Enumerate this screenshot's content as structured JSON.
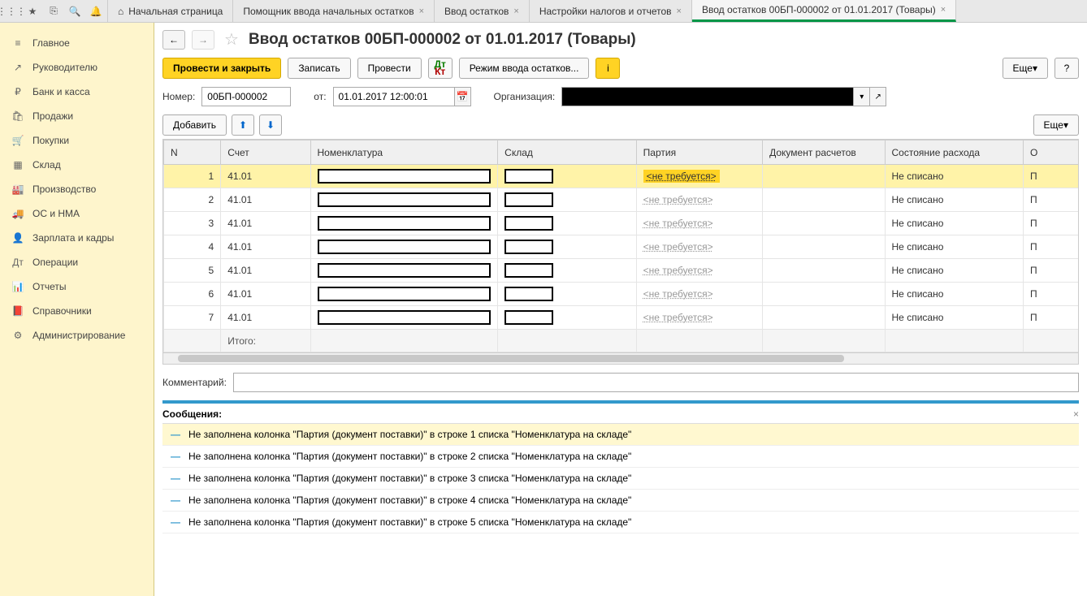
{
  "toolbar_icons": [
    "apps",
    "star",
    "clipboard",
    "search",
    "bell"
  ],
  "tabs": [
    {
      "label": "Начальная страница",
      "closable": false,
      "home": true
    },
    {
      "label": "Помощник ввода начальных остатков",
      "closable": true
    },
    {
      "label": "Ввод остатков",
      "closable": true
    },
    {
      "label": "Настройки налогов и отчетов",
      "closable": true
    },
    {
      "label": "Ввод остатков 00БП-000002 от 01.01.2017 (Товары)",
      "closable": true,
      "active": true
    }
  ],
  "sidebar": [
    {
      "icon": "≡",
      "label": "Главное"
    },
    {
      "icon": "↗",
      "label": "Руководителю"
    },
    {
      "icon": "₽",
      "label": "Банк и касса"
    },
    {
      "icon": "🛍",
      "label": "Продажи"
    },
    {
      "icon": "🛒",
      "label": "Покупки"
    },
    {
      "icon": "▦",
      "label": "Склад"
    },
    {
      "icon": "🏭",
      "label": "Производство"
    },
    {
      "icon": "🚚",
      "label": "ОС и НМА"
    },
    {
      "icon": "👤",
      "label": "Зарплата и кадры"
    },
    {
      "icon": "Дт",
      "label": "Операции"
    },
    {
      "icon": "📊",
      "label": "Отчеты"
    },
    {
      "icon": "📕",
      "label": "Справочники"
    },
    {
      "icon": "⚙",
      "label": "Администрирование"
    }
  ],
  "page_title": "Ввод остатков 00БП-000002 от 01.01.2017 (Товары)",
  "actions": {
    "post_close": "Провести и закрыть",
    "write": "Записать",
    "post": "Провести",
    "mode": "Режим ввода остатков...",
    "more": "Еще",
    "help": "?"
  },
  "form": {
    "number_label": "Номер:",
    "number_value": "00БП-000002",
    "from_label": "от:",
    "date_value": "01.01.2017 12:00:01",
    "org_label": "Организация:"
  },
  "table_toolbar": {
    "add": "Добавить",
    "more": "Еще"
  },
  "columns": {
    "n": "N",
    "account": "Счет",
    "nomenclature": "Номенклатура",
    "warehouse": "Склад",
    "party": "Партия",
    "doc": "Документ расчетов",
    "state": "Состояние расхода",
    "last": "О"
  },
  "rows": [
    {
      "n": "1",
      "account": "41.01",
      "party": "<не требуется>",
      "state": "Не списано",
      "last": "П",
      "selected": true
    },
    {
      "n": "2",
      "account": "41.01",
      "party": "<не требуется>",
      "state": "Не списано",
      "last": "П"
    },
    {
      "n": "3",
      "account": "41.01",
      "party": "<не требуется>",
      "state": "Не списано",
      "last": "П"
    },
    {
      "n": "4",
      "account": "41.01",
      "party": "<не требуется>",
      "state": "Не списано",
      "last": "П"
    },
    {
      "n": "5",
      "account": "41.01",
      "party": "<не требуется>",
      "state": "Не списано",
      "last": "П"
    },
    {
      "n": "6",
      "account": "41.01",
      "party": "<не требуется>",
      "state": "Не списано",
      "last": "П"
    },
    {
      "n": "7",
      "account": "41.01",
      "party": "<не требуется>",
      "state": "Не списано",
      "last": "П"
    }
  ],
  "footer_label": "Итого:",
  "comment_label": "Комментарий:",
  "messages_title": "Сообщения:",
  "messages": [
    {
      "text": "Не заполнена колонка \"Партия (документ поставки)\" в строке 1 списка \"Номенклатура на складе\"",
      "highlight": true
    },
    {
      "text": "Не заполнена колонка \"Партия (документ поставки)\" в строке 2 списка \"Номенклатура на складе\""
    },
    {
      "text": "Не заполнена колонка \"Партия (документ поставки)\" в строке 3 списка \"Номенклатура на складе\""
    },
    {
      "text": "Не заполнена колонка \"Партия (документ поставки)\" в строке 4 списка \"Номенклатура на складе\""
    },
    {
      "text": "Не заполнена колонка \"Партия (документ поставки)\" в строке 5 списка \"Номенклатура на складе\""
    }
  ]
}
